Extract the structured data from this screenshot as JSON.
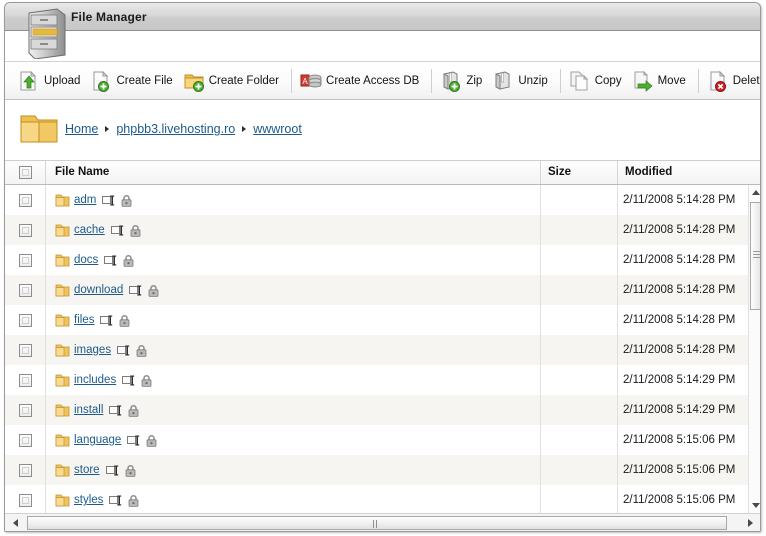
{
  "window": {
    "title": "File Manager",
    "cabinet_icon": "file-cabinet-icon"
  },
  "toolbar": {
    "buttons": [
      {
        "label": "Upload",
        "icon": "upload-icon"
      },
      {
        "label": "Create File",
        "icon": "create-file-icon"
      },
      {
        "label": "Create Folder",
        "icon": "create-folder-icon"
      },
      {
        "label": "Create Access DB",
        "icon": "create-access-db-icon"
      },
      {
        "label": "Zip",
        "icon": "zip-icon"
      },
      {
        "label": "Unzip",
        "icon": "unzip-icon"
      },
      {
        "label": "Copy",
        "icon": "copy-icon"
      },
      {
        "label": "Move",
        "icon": "move-icon"
      },
      {
        "label": "Delete",
        "icon": "delete-icon"
      }
    ]
  },
  "breadcrumb": {
    "folder_icon": "open-folder-icon",
    "items": [
      {
        "label": "Home"
      },
      {
        "label": "phpbb3.livehosting.ro"
      },
      {
        "label": "wwwroot"
      }
    ],
    "separator": "▶"
  },
  "table": {
    "columns": [
      {
        "key": "select",
        "label": ""
      },
      {
        "key": "name",
        "label": "File Name"
      },
      {
        "key": "size",
        "label": "Size"
      },
      {
        "key": "modified",
        "label": "Modified"
      }
    ],
    "rows": [
      {
        "name": "adm",
        "size": "",
        "modified": "2/11/2008 5:14:28 PM",
        "icon": "folder-icon",
        "rename_icon": "rename-icon",
        "lock_icon": "permissions-lock-icon"
      },
      {
        "name": "cache",
        "size": "",
        "modified": "2/11/2008 5:14:28 PM",
        "icon": "folder-icon",
        "rename_icon": "rename-icon",
        "lock_icon": "permissions-lock-icon"
      },
      {
        "name": "docs",
        "size": "",
        "modified": "2/11/2008 5:14:28 PM",
        "icon": "folder-icon",
        "rename_icon": "rename-icon",
        "lock_icon": "permissions-lock-icon"
      },
      {
        "name": "download",
        "size": "",
        "modified": "2/11/2008 5:14:28 PM",
        "icon": "folder-icon",
        "rename_icon": "rename-icon",
        "lock_icon": "permissions-lock-icon"
      },
      {
        "name": "files",
        "size": "",
        "modified": "2/11/2008 5:14:28 PM",
        "icon": "folder-icon",
        "rename_icon": "rename-icon",
        "lock_icon": "permissions-lock-icon"
      },
      {
        "name": "images",
        "size": "",
        "modified": "2/11/2008 5:14:28 PM",
        "icon": "folder-icon",
        "rename_icon": "rename-icon",
        "lock_icon": "permissions-lock-icon"
      },
      {
        "name": "includes",
        "size": "",
        "modified": "2/11/2008 5:14:29 PM",
        "icon": "folder-icon",
        "rename_icon": "rename-icon",
        "lock_icon": "permissions-lock-icon"
      },
      {
        "name": "install",
        "size": "",
        "modified": "2/11/2008 5:14:29 PM",
        "icon": "folder-icon",
        "rename_icon": "rename-icon",
        "lock_icon": "permissions-lock-icon"
      },
      {
        "name": "language",
        "size": "",
        "modified": "2/11/2008 5:15:06 PM",
        "icon": "folder-icon",
        "rename_icon": "rename-icon",
        "lock_icon": "permissions-lock-icon"
      },
      {
        "name": "store",
        "size": "",
        "modified": "2/11/2008 5:15:06 PM",
        "icon": "folder-icon",
        "rename_icon": "rename-icon",
        "lock_icon": "permissions-lock-icon"
      },
      {
        "name": "styles",
        "size": "",
        "modified": "2/11/2008 5:15:06 PM",
        "icon": "folder-icon",
        "rename_icon": "rename-icon",
        "lock_icon": "permissions-lock-icon"
      }
    ]
  },
  "colors": {
    "link": "#1c5b8c",
    "titlebar": "#d3d3d3",
    "row_alt": "#f7f5f1",
    "folder": "#f2c75c",
    "accent_green": "#4caf2f",
    "accent_red": "#cc2222"
  }
}
